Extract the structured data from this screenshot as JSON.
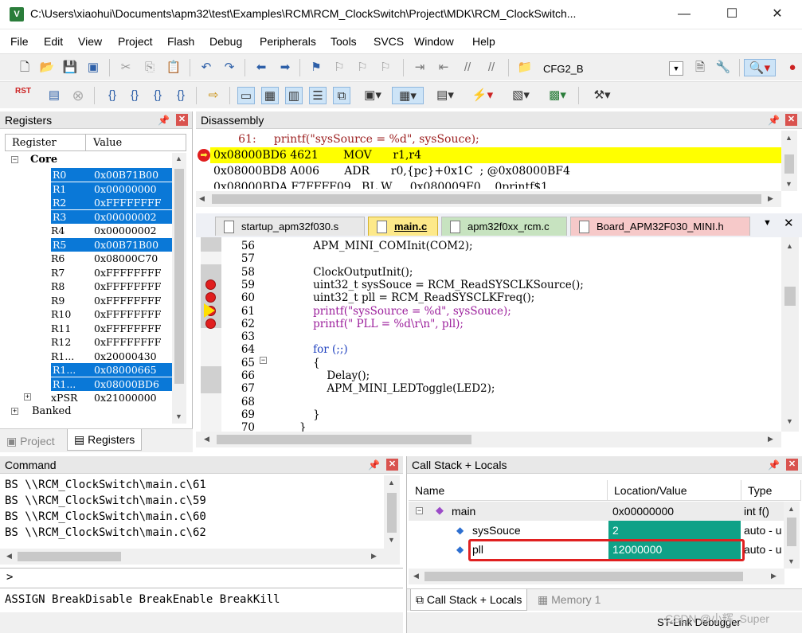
{
  "window": {
    "title": "C:\\Users\\xiaohui\\Documents\\apm32\\test\\Examples\\RCM\\RCM_ClockSwitch\\Project\\MDK\\RCM_ClockSwitch...",
    "icon_label": "V"
  },
  "menu": [
    "File",
    "Edit",
    "View",
    "Project",
    "Flash",
    "Debug",
    "Peripherals",
    "Tools",
    "SVCS",
    "Window",
    "Help"
  ],
  "toolbar1": {
    "target_name": "CFG2_B"
  },
  "toolbar2": {
    "reset_label": "RST"
  },
  "registers": {
    "title": "Registers",
    "col_register": "Register",
    "col_value": "Value",
    "group": "Core",
    "rows": [
      {
        "name": "R0",
        "value": "0x00B71B00",
        "selected": true
      },
      {
        "name": "R1",
        "value": "0x00000000",
        "selected": true
      },
      {
        "name": "R2",
        "value": "0xFFFFFFFF",
        "selected": true
      },
      {
        "name": "R3",
        "value": "0x00000002",
        "selected": true
      },
      {
        "name": "R4",
        "value": "0x00000002",
        "selected": false
      },
      {
        "name": "R5",
        "value": "0x00B71B00",
        "selected": true
      },
      {
        "name": "R6",
        "value": "0x08000C70",
        "selected": false
      },
      {
        "name": "R7",
        "value": "0xFFFFFFFF",
        "selected": false
      },
      {
        "name": "R8",
        "value": "0xFFFFFFFF",
        "selected": false
      },
      {
        "name": "R9",
        "value": "0xFFFFFFFF",
        "selected": false
      },
      {
        "name": "R10",
        "value": "0xFFFFFFFF",
        "selected": false
      },
      {
        "name": "R11",
        "value": "0xFFFFFFFF",
        "selected": false
      },
      {
        "name": "R12",
        "value": "0xFFFFFFFF",
        "selected": false
      },
      {
        "name": "R1...",
        "value": "0x20000430",
        "selected": false
      },
      {
        "name": "R1...",
        "value": "0x08000665",
        "selected": true
      },
      {
        "name": "R1...",
        "value": "0x08000BD6",
        "selected": true
      },
      {
        "name": "xPSR",
        "value": "0x21000000",
        "selected": false
      }
    ],
    "banked": "Banked",
    "tab_project": "Project",
    "tab_registers": "Registers"
  },
  "disassembly": {
    "title": "Disassembly",
    "lines": [
      "       61:     printf(\"sysSource = %d\", sysSouce);",
      "0x08000BD6 4621       MOV      r1,r4",
      "0x08000BD8 A006       ADR      r0,{pc}+0x1C  ; @0x08000BF4",
      "0x08000BDA F7FFFF09   BL.W     0x080009F0    0printf$1"
    ]
  },
  "editor": {
    "tabs": [
      "startup_apm32f030.s",
      "main.c",
      "apm32f0xx_rcm.c",
      "Board_APM32F030_MINI.h"
    ],
    "lines": [
      {
        "n": "56",
        "code": "    APM_MINI_COMInit(COM2);"
      },
      {
        "n": "57",
        "code": ""
      },
      {
        "n": "58",
        "code": "    ClockOutputInit();"
      },
      {
        "n": "59",
        "code": "    uint32_t sysSouce = RCM_ReadSYSCLKSource();"
      },
      {
        "n": "60",
        "code": "    uint32_t pll = RCM_ReadSYSCLKFreq();"
      },
      {
        "n": "61",
        "code": "    printf(\"sysSource = %d\", sysSouce);"
      },
      {
        "n": "62",
        "code": "    printf(\" PLL = %d\\r\\n\", pll);"
      },
      {
        "n": "63",
        "code": ""
      },
      {
        "n": "64",
        "code": "    for (;;)"
      },
      {
        "n": "65",
        "code": "    {"
      },
      {
        "n": "66",
        "code": "        Delay();"
      },
      {
        "n": "67",
        "code": "        APM_MINI_LEDToggle(LED2);"
      },
      {
        "n": "68",
        "code": ""
      },
      {
        "n": "69",
        "code": "    }"
      },
      {
        "n": "70",
        "code": "}"
      }
    ]
  },
  "command": {
    "title": "Command",
    "lines": [
      "BS \\\\RCM_ClockSwitch\\main.c\\61",
      "BS \\\\RCM_ClockSwitch\\main.c\\59",
      "BS \\\\RCM_ClockSwitch\\main.c\\60",
      "BS \\\\RCM_ClockSwitch\\main.c\\62"
    ],
    "prompt": ">",
    "hint": "ASSIGN BreakDisable BreakEnable BreakKill"
  },
  "callstack": {
    "title": "Call Stack + Locals",
    "col_name": "Name",
    "col_location": "Location/Value",
    "col_type": "Type",
    "rows": [
      {
        "name": "main",
        "value": "0x00000000",
        "type": "int f()"
      },
      {
        "name": "sysSouce",
        "value": "2",
        "type": "auto - u"
      },
      {
        "name": "pll",
        "value": "12000000",
        "type": "auto - u"
      }
    ],
    "tab_callstack": "Call Stack + Locals",
    "tab_memory": "Memory 1"
  },
  "status": {
    "debugger": "ST-Link Debugger",
    "watermark": "CSDN @小辉_Super"
  },
  "colors": {
    "selection": "#0a78d7",
    "teal": "#0fa187",
    "current_line": "#ffff00",
    "highlight_box": "#e02020"
  }
}
